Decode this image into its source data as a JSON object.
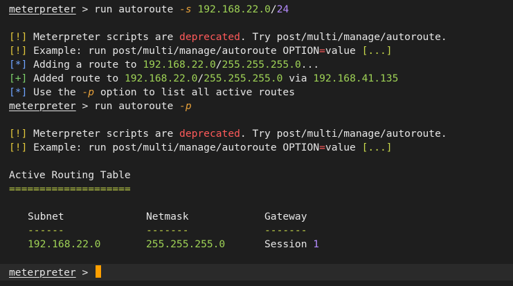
{
  "prompt": "meterpreter",
  "prompt_sep": ">",
  "cmd1": {
    "text": "run autoroute",
    "flag": "-s",
    "ip": "192.168.22.0",
    "slash": "/",
    "cidr": "24"
  },
  "msgs1": [
    {
      "tag": "[!]",
      "pre": "Meterpreter scripts are ",
      "hl": "deprecated",
      "post": ". Try post/multi/manage/autoroute."
    },
    {
      "tag": "[!]",
      "pre": "Example: run post/multi/manage/autoroute OPTION",
      "eq": "=",
      "mid": "value ",
      "br": "[...]"
    },
    {
      "tag": "[*]",
      "pre": "Adding a route to ",
      "ip": "192.168.22.0",
      "slash": "/",
      "mask": "255.255.255.0",
      "post": "..."
    },
    {
      "tag": "[+]",
      "pre": "Added route to ",
      "ip": "192.168.22.0",
      "slash": "/",
      "mask": "255.255.255.0",
      "mid": " via ",
      "gw": "192.168.41.135"
    },
    {
      "tag": "[*]",
      "pre": "Use the ",
      "flag": "-p",
      "post": " option to list all active routes"
    }
  ],
  "cmd2": {
    "text": "run autoroute",
    "flag": "-p"
  },
  "msgs2": [
    {
      "tag": "[!]",
      "pre": "Meterpreter scripts are ",
      "hl": "deprecated",
      "post": ". Try post/multi/manage/autoroute."
    },
    {
      "tag": "[!]",
      "pre": "Example: run post/multi/manage/autoroute OPTION",
      "eq": "=",
      "mid": "value ",
      "br": "[...]"
    }
  ],
  "table": {
    "title": "Active Routing Table",
    "underline": "====================",
    "headers": [
      "Subnet",
      "Netmask",
      "Gateway"
    ],
    "dashes": [
      "------",
      "-------",
      "-------"
    ],
    "row": {
      "subnet": "192.168.22.0",
      "netmask": "255.255.255.0",
      "gateway_label": "Session ",
      "gateway_id": "1"
    }
  },
  "colors": {
    "background": "#1e1e1e",
    "text": "#e6e6e6",
    "cursor": "#ffa000"
  }
}
